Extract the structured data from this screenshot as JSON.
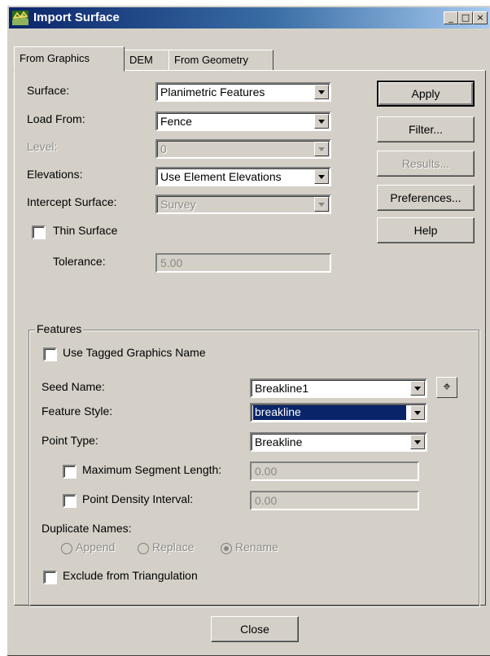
{
  "window": {
    "title": "Import Surface",
    "minimize": "_",
    "maximize": "□",
    "close": "×"
  },
  "tabs": [
    {
      "label": "From Graphics",
      "active": true
    },
    {
      "label": "DEM",
      "active": false
    },
    {
      "label": "From Geometry",
      "active": false
    }
  ],
  "form": {
    "surface_label": "Surface:",
    "surface_value": "Planimetric Features",
    "load_from_label": "Load From:",
    "load_from_value": "Fence",
    "level_label": "Level:",
    "level_value": "0",
    "elevations_label": "Elevations:",
    "elevations_value": "Use Element Elevations",
    "intercept_label": "Intercept Surface:",
    "intercept_value": "Survey",
    "thin_surface_label": "Thin Surface",
    "tolerance_label": "Tolerance:",
    "tolerance_value": "5.00"
  },
  "buttons": {
    "apply": "Apply",
    "filter": "Filter...",
    "results": "Results...",
    "preferences": "Preferences...",
    "help": "Help",
    "close": "Close"
  },
  "features": {
    "group_title": "Features",
    "use_tagged_label": "Use Tagged Graphics Name",
    "seed_name_label": "Seed Name:",
    "seed_name_value": "Breakline1",
    "feature_style_label": "Feature Style:",
    "feature_style_value": "breakline",
    "point_type_label": "Point Type:",
    "point_type_value": "Breakline",
    "max_segment_label": "Maximum Segment Length:",
    "max_segment_value": "0.00",
    "point_density_label": "Point Density Interval:",
    "point_density_value": "0.00",
    "duplicate_names_label": "Duplicate Names:",
    "append_label": "Append",
    "replace_label": "Replace",
    "rename_label": "Rename",
    "rename_selected": true,
    "exclude_label": "Exclude from Triangulation"
  },
  "colors": {
    "titlebar": "#0a246a",
    "face": "#d4d0c8",
    "selection": "#0a246a"
  }
}
